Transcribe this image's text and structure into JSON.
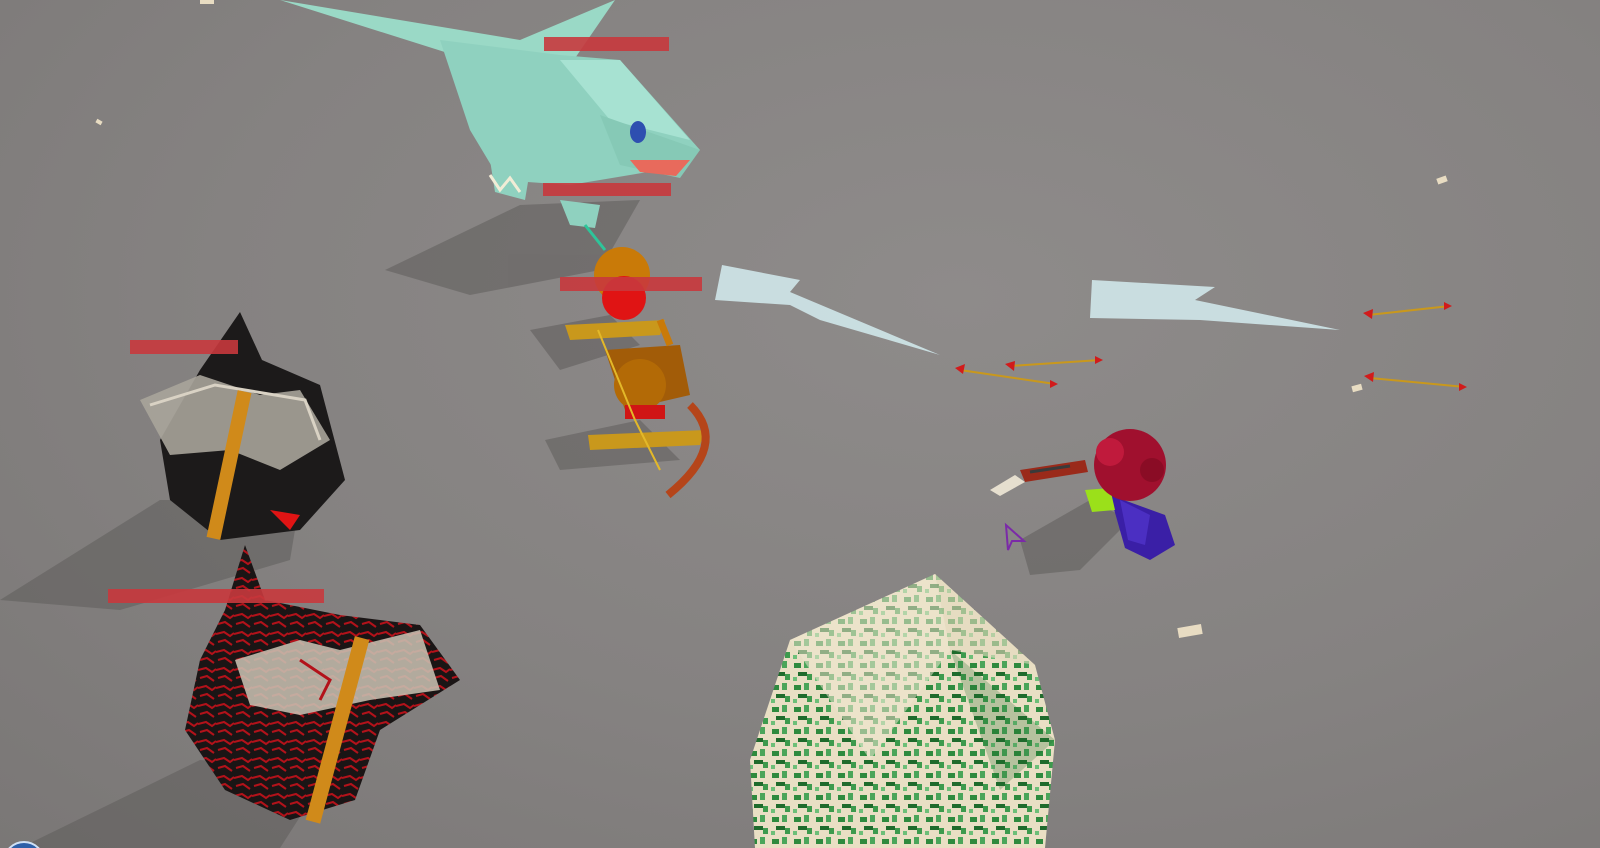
{
  "game": {
    "name": "",
    "colors": {
      "ground": "#878483",
      "health_bar": "#c8383d",
      "dragon": "#8fd1bf",
      "ice": "#cfe7ea",
      "arrow_shaft": "#c9981c",
      "arrow_head": "#d11b1b",
      "mage_hair": "#a0102e",
      "mage_cape": "#3a1fa6",
      "skeleton_body": "#b36a06",
      "dark_knight": "#1c1a1a",
      "crystal_green": "#2e8a3e",
      "crystal_cream": "#efe6cf"
    }
  },
  "entities": {
    "dragon": {
      "kind": "frost-dragon",
      "health": 1.0
    },
    "dragon_lower_bar": {
      "health": 1.0
    },
    "skeleton_archer": {
      "kind": "skeleton-archer",
      "health": 1.0
    },
    "knight_upper": {
      "kind": "dark-knight",
      "health": 1.0
    },
    "knight_lower": {
      "kind": "dark-knight-burning",
      "health": 1.0
    },
    "player": {
      "kind": "mage-player",
      "weapon": "crossbow"
    },
    "crystal": {
      "kind": "green-crystal-obstacle"
    }
  },
  "projectiles": {
    "ice_shards": 2,
    "arrows": 4
  },
  "cursor": {
    "icon": "triangle-pointer-icon"
  }
}
